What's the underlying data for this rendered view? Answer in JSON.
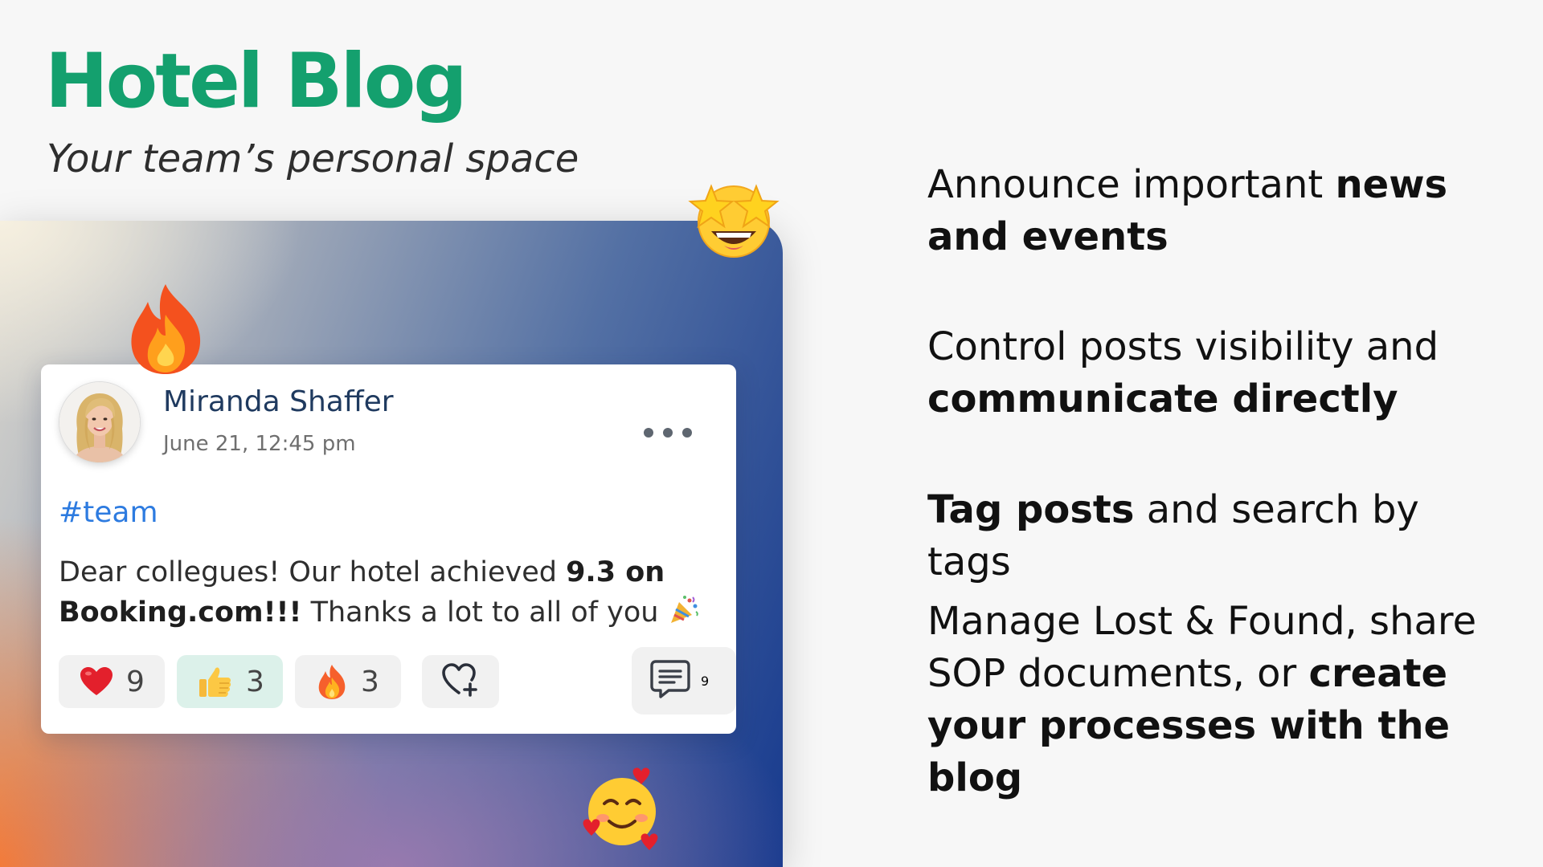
{
  "header": {
    "title": "Hotel Blog",
    "subtitle": "Your team’s personal space"
  },
  "post": {
    "author": "Miranda Shaffer",
    "date": "June 21, 12:45 pm",
    "tag": "#team",
    "body": {
      "part1": "Dear collegues! Our hotel achieved ",
      "bold": "9.3 on Booking.com!!!",
      "part2": " Thanks a lot to all of you"
    },
    "reactions": [
      {
        "icon": "heart-icon",
        "count": "9",
        "active": false
      },
      {
        "icon": "thumbs-up-icon",
        "count": "3",
        "active": true
      },
      {
        "icon": "fire-icon",
        "count": "3",
        "active": false
      }
    ],
    "add_reaction_icon": "heart-plus-icon",
    "comments": {
      "icon": "comment-icon",
      "count": "9"
    }
  },
  "decorations": [
    "star-struck-emoji",
    "fire-emoji",
    "smiling-face-with-hearts-emoji",
    "party-popper-emoji"
  ],
  "features": [
    {
      "pre": "Announce important ",
      "bold": "news and events",
      "post": ""
    },
    {
      "pre": "Control posts visibility and ",
      "bold": "communicate directly",
      "post": ""
    },
    {
      "pre": "",
      "bold": "Tag posts",
      "post": " and search by tags"
    },
    {
      "pre": "Manage Lost & Found, share SOP documents, or ",
      "bold": "create your processes with the blog",
      "post": ""
    }
  ],
  "colors": {
    "title": "#14a06e",
    "author": "#1f3a5f",
    "tag": "#2d7be0",
    "active_reaction_bg": "#dcf1ea"
  }
}
